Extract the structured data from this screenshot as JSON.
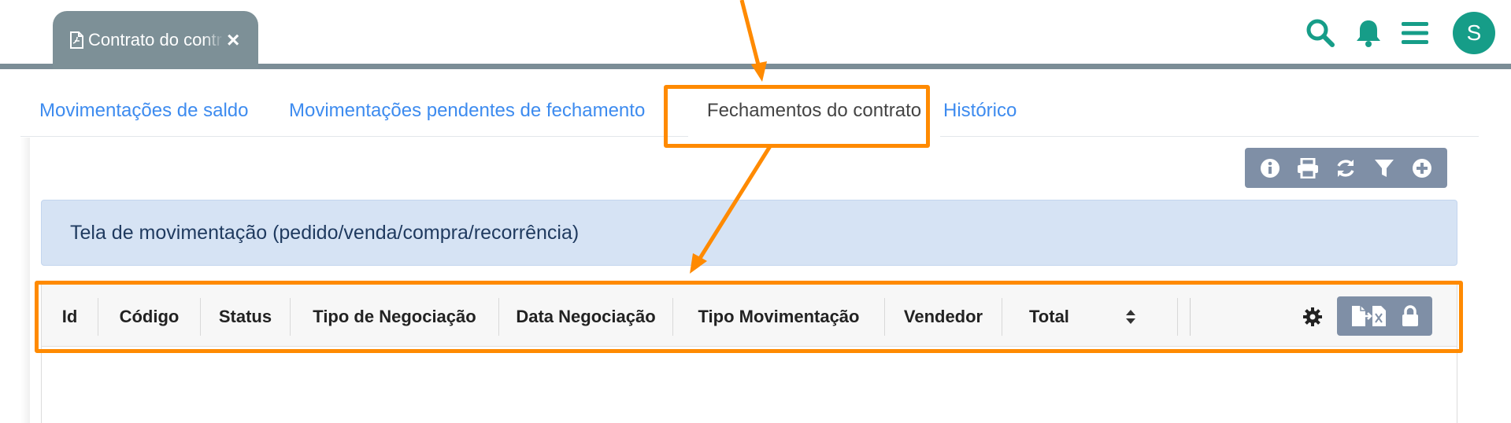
{
  "top_tab": {
    "title": "Contrato do contrato",
    "close_label": "×"
  },
  "user": {
    "avatar_initial": "S"
  },
  "icons": {
    "search": "search-icon",
    "notifications": "bell-icon",
    "menu": "hamburger-menu-icon",
    "info": "info-icon",
    "print": "printer-icon",
    "refresh": "refresh-icon",
    "filter": "filter-icon",
    "add": "plus-circle-icon",
    "settings": "gear-icon",
    "export": "export-excel-icon",
    "lock": "lock-icon"
  },
  "tabs": [
    {
      "label": "Movimentações de saldo",
      "active": false
    },
    {
      "label": "Movimentações pendentes de fechamento",
      "active": false
    },
    {
      "label": "Fechamentos do contrato",
      "active": true
    },
    {
      "label": "Histórico",
      "active": false
    }
  ],
  "banner": {
    "text": "Tela de movimentação (pedido/venda/compra/recorrência)"
  },
  "table": {
    "columns": [
      "Id",
      "Código",
      "Status",
      "Tipo de Negociação",
      "Data Negociação",
      "Tipo Movimentação",
      "Vendedor",
      "Total"
    ],
    "rows": []
  },
  "colors": {
    "accent_teal": "#169d88",
    "tab_link": "#3d8bef",
    "toolbar_bg": "#7f8fa6",
    "banner_bg": "#d6e3f4",
    "annotation_orange": "#ff8a00"
  }
}
